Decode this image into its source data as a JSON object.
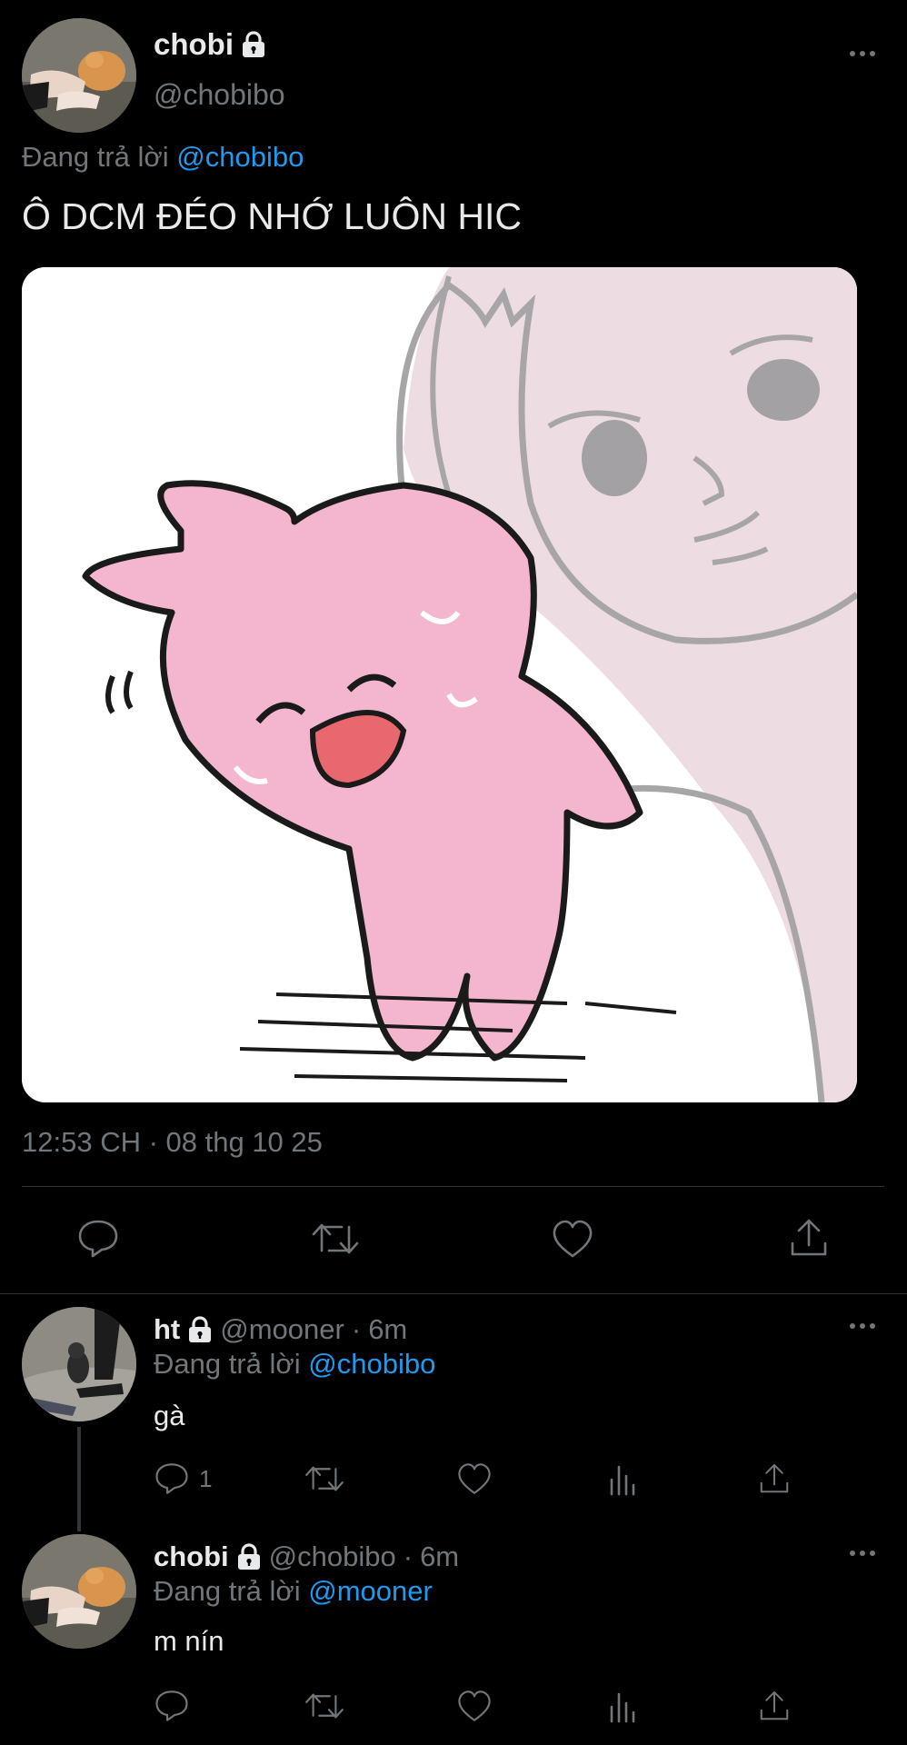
{
  "main_tweet": {
    "display_name": "chobi",
    "handle": "@chobibo",
    "reply_prefix": "Đang trả lời",
    "reply_to": "@chobibo",
    "text": "Ô DCM ĐÉO NHỚ LUÔN HIC",
    "timestamp": "12:53 CH · 08 thg 10 25",
    "image_icon": "pink-bunny-sticker",
    "actions": [
      "reply-icon",
      "retweet-icon",
      "like-icon",
      "share-icon"
    ]
  },
  "replies": [
    {
      "display_name": "ht",
      "handle": "@mooner",
      "sep": "·",
      "time": "6m",
      "reply_prefix": "Đang trả lời",
      "reply_to": "@chobibo",
      "text": "gà",
      "reply_count": "1"
    },
    {
      "display_name": "chobi",
      "handle": "@chobibo",
      "sep": "·",
      "time": "6m",
      "reply_prefix": "Đang trả lời",
      "reply_to": "@mooner",
      "text": "m nín",
      "reply_count": ""
    }
  ],
  "colors": {
    "background": "#000000",
    "text": "#e7e9ea",
    "muted": "#71767b",
    "accent": "#1d9bf0",
    "sticker_pink": "#f4b6cf"
  }
}
